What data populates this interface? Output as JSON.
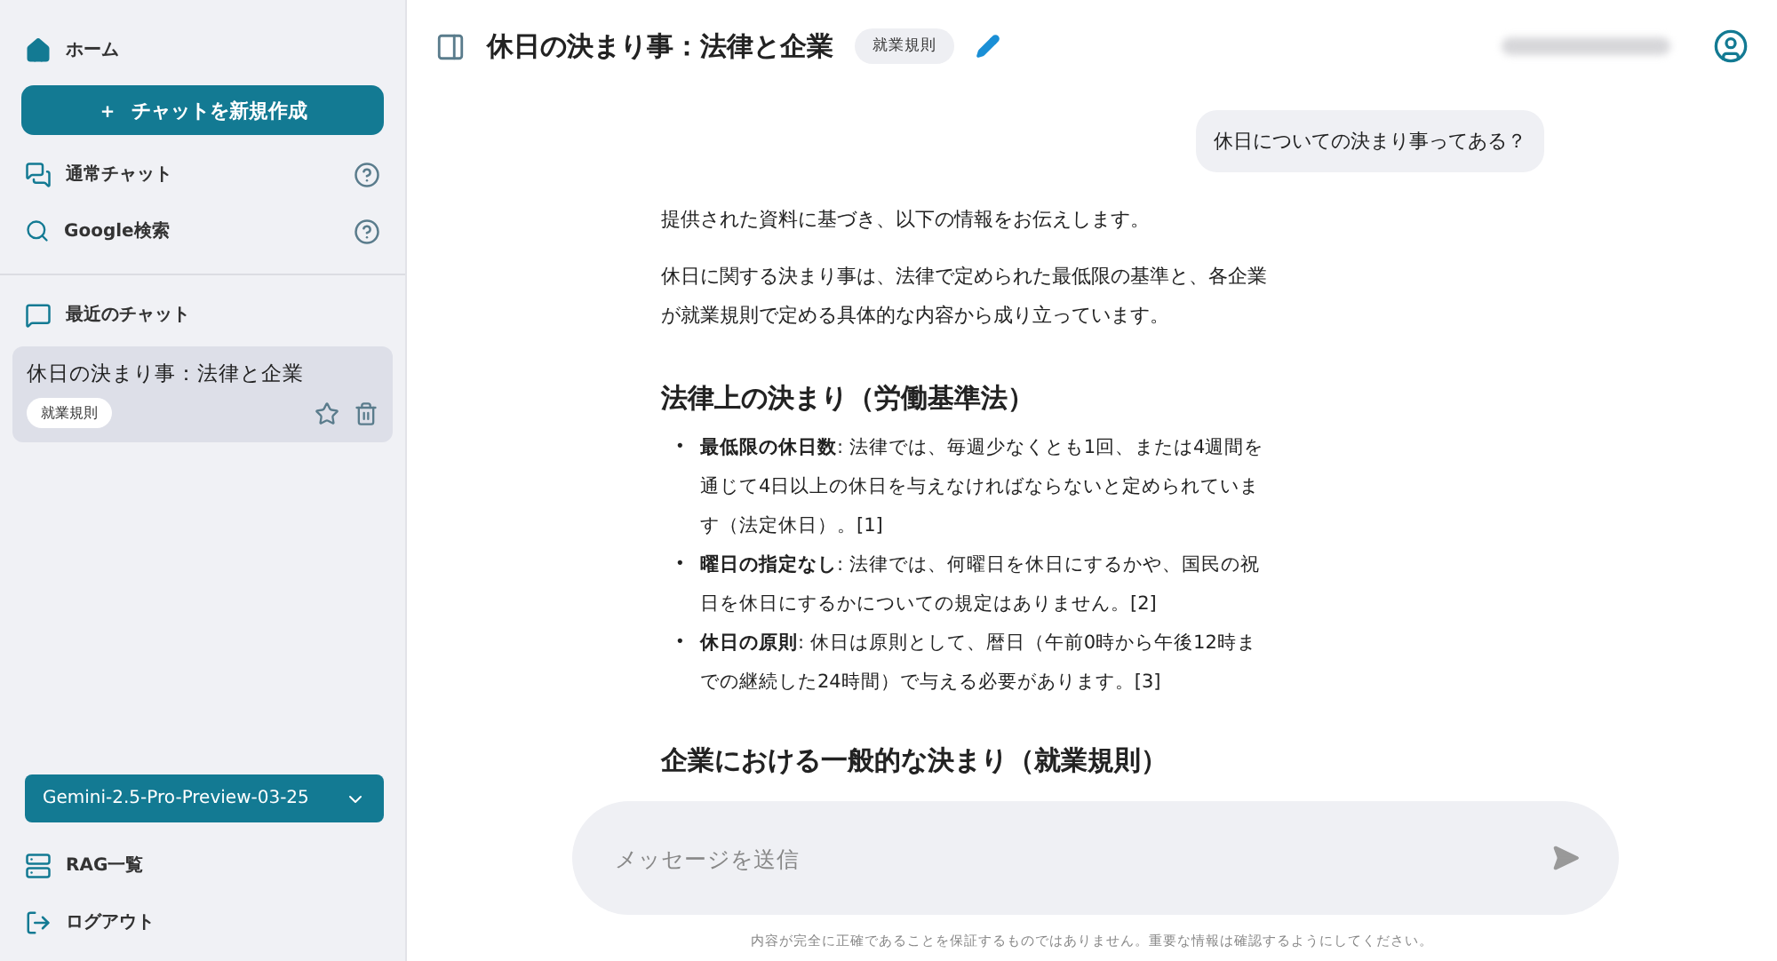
{
  "sidebar": {
    "home": {
      "label": "ホーム"
    },
    "new_chat_button": {
      "label": "チャットを新規作成",
      "icon": "＋"
    },
    "modes": [
      {
        "kind": "chat",
        "label": "通常チャット"
      },
      {
        "kind": "search",
        "label": "Google検索"
      }
    ],
    "recent": {
      "title": "最近のチャット",
      "chats": [
        {
          "title": "休日の決まり事：法律と企業",
          "tag": "就業規則",
          "selected": true,
          "starred": false
        }
      ]
    },
    "model_select": {
      "value": "Gemini-2.5-Pro-Preview-03-25"
    },
    "links": [
      {
        "kind": "rag",
        "label": "RAG一覧"
      },
      {
        "kind": "logout",
        "label": "ログアウト"
      }
    ]
  },
  "header": {
    "title": "休日の決まり事：法律と企業",
    "tag": "就業規則"
  },
  "messages": [
    {
      "kind": "user",
      "text": "休日についての決まり事ってある？"
    },
    {
      "kind": "assistant",
      "blocks": [
        {
          "kind": "p",
          "text": "提供された資料に基づき、以下の情報をお伝えします。"
        },
        {
          "kind": "p",
          "text": "休日に関する決まり事は、法律で定められた最低限の基準と、各企業が就業規則で定める具体的な内容から成り立っています。"
        },
        {
          "kind": "h",
          "text": "法律上の決まり（労働基準法）"
        },
        {
          "kind": "ul",
          "items": [
            {
              "bullet": "•",
              "text": "**最低限の休日数**: 法律では、毎週少なくとも1回、または4週間を通じて4日以上の休日を与えなければならないと定められています（法定休日）。[1]"
            },
            {
              "bullet": "•",
              "text": "**曜日の指定なし**: 法律では、何曜日を休日にするかや、国民の祝日を休日にするかについての規定はありません。[2]"
            },
            {
              "bullet": "•",
              "text": "**休日の原則**: 休日は原則として、暦日（午前0時から午後12時までの継続した24時間）で与える必要があります。[3]"
            }
          ]
        },
        {
          "kind": "h",
          "text": "企業における一般的な決まり（就業規則）"
        }
      ]
    }
  ],
  "composer": {
    "placeholder": "メッセージを送信"
  },
  "disclaimer": "内容が完全に正確であることを保証するものではありません。重要な情報は確認するようにしてください。"
}
